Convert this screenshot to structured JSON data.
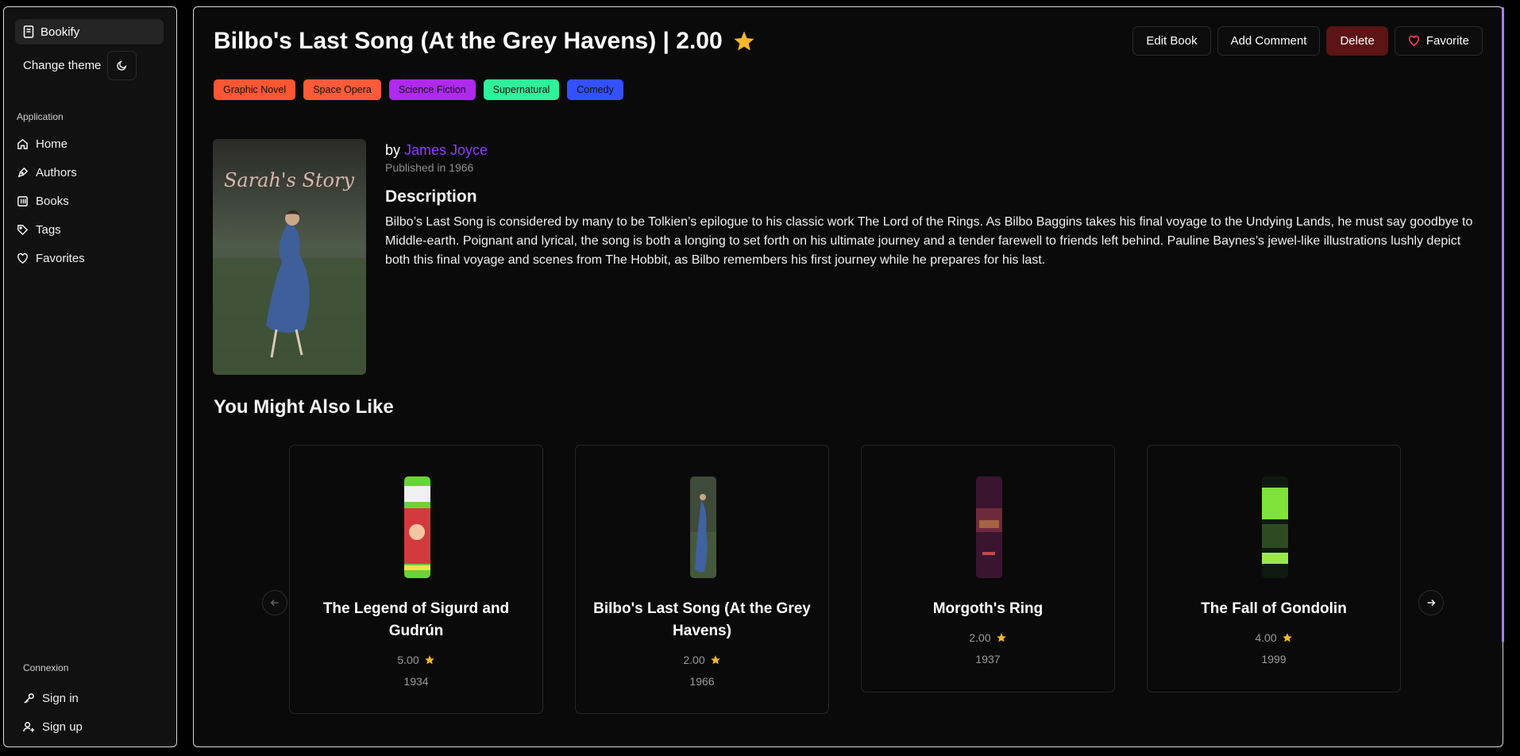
{
  "sidebar": {
    "brand": "Bookify",
    "change_theme": "Change theme",
    "section_app": "Application",
    "items": [
      {
        "label": "Home",
        "icon": "home-icon"
      },
      {
        "label": "Authors",
        "icon": "pen-icon"
      },
      {
        "label": "Books",
        "icon": "library-icon"
      },
      {
        "label": "Tags",
        "icon": "tag-icon"
      },
      {
        "label": "Favorites",
        "icon": "heart-icon"
      }
    ],
    "section_conn": "Connexion",
    "sign_in": "Sign in",
    "sign_up": "Sign up"
  },
  "book": {
    "title": "Bilbo's Last Song (At the Grey Havens) | 2.00",
    "by": "by",
    "author": "James Joyce",
    "published": "Published in 1966",
    "description_title": "Description",
    "description": "Bilbo’s Last Song is considered by many to be Tolkien’s epilogue to his classic work The Lord of the Rings. As Bilbo Baggins takes his final voyage to the Undying Lands, he must say goodbye to Middle-earth. Poignant and lyrical, the song is both a longing to set forth on his ultimate journey and a tender farewell to friends left behind. Pauline Baynes’s jewel-like illustrations lushly depict both this final voyage and scenes from The Hobbit, as Bilbo remembers his first journey while he prepares for his last.",
    "cover_text": "Sarah's Story"
  },
  "actions": {
    "edit": "Edit Book",
    "comment": "Add Comment",
    "delete": "Delete",
    "favorite": "Favorite"
  },
  "tags": [
    {
      "label": "Graphic Novel",
      "color": "#ff5733"
    },
    {
      "label": "Space Opera",
      "color": "#ff5b3a"
    },
    {
      "label": "Science Fiction",
      "color": "#b029ef"
    },
    {
      "label": "Supernatural",
      "color": "#2ef29a"
    },
    {
      "label": "Comedy",
      "color": "#3351ff"
    }
  ],
  "recommend": {
    "heading": "You Might Also Like",
    "cards": [
      {
        "title": "The Legend of Sigurd and Gudrún",
        "rating": "5.00",
        "year": "1934"
      },
      {
        "title": "Bilbo's Last Song (At the Grey Havens)",
        "rating": "2.00",
        "year": "1966"
      },
      {
        "title": "Morgoth's Ring",
        "rating": "2.00",
        "year": "1937"
      },
      {
        "title": "The Fall of Gondolin",
        "rating": "4.00",
        "year": "1999"
      }
    ]
  },
  "colors": {
    "accent": "#8b3dff",
    "star": "#f5b82e",
    "danger": "#5c1414"
  }
}
